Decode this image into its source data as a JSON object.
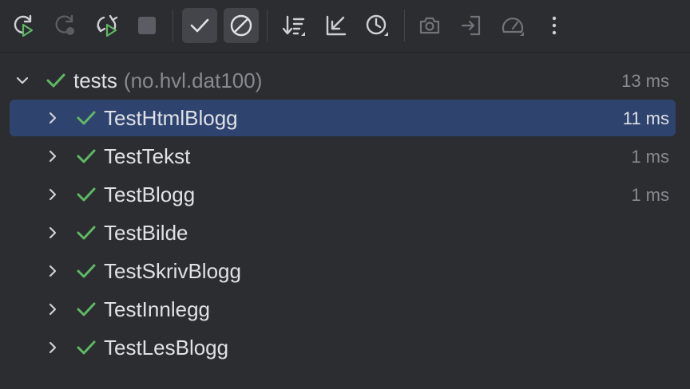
{
  "toolbar": {
    "buttons": [
      {
        "name": "rerun",
        "icon": "rerun-icon"
      },
      {
        "name": "rerun-failed",
        "icon": "rerun-failed-icon"
      },
      {
        "name": "toggle-auto-test",
        "icon": "auto-rerun-icon"
      },
      {
        "name": "stop",
        "icon": "stop-icon"
      },
      {
        "name": "show-passed",
        "icon": "checkmark-icon",
        "toggled": true
      },
      {
        "name": "show-ignored",
        "icon": "ignored-icon",
        "toggled": true
      },
      {
        "name": "sort-alphabetically",
        "icon": "sort-icon"
      },
      {
        "name": "collapse-all",
        "icon": "collapse-icon"
      },
      {
        "name": "sort-by-duration",
        "icon": "clock-icon"
      },
      {
        "name": "import-tests",
        "icon": "camera-icon"
      },
      {
        "name": "export-tests",
        "icon": "export-icon"
      },
      {
        "name": "coverage",
        "icon": "gauge-icon"
      },
      {
        "name": "more",
        "icon": "more-vertical-icon"
      }
    ]
  },
  "tree": {
    "root": {
      "name": "tests",
      "package": "(no.hvl.dat100)",
      "duration": "13 ms",
      "status": "passed",
      "expanded": true
    },
    "children": [
      {
        "name": "TestHtmlBlogg",
        "duration": "11 ms",
        "selected": true,
        "status": "passed"
      },
      {
        "name": "TestTekst",
        "duration": "1 ms",
        "status": "passed"
      },
      {
        "name": "TestBlogg",
        "duration": "1 ms",
        "status": "passed"
      },
      {
        "name": "TestBilde",
        "duration": "",
        "status": "passed"
      },
      {
        "name": "TestSkrivBlogg",
        "duration": "",
        "status": "passed"
      },
      {
        "name": "TestInnlegg",
        "duration": "",
        "status": "passed"
      },
      {
        "name": "TestLesBlogg",
        "duration": "",
        "status": "passed"
      }
    ]
  },
  "colors": {
    "background": "#2b2d30",
    "selection": "#2e436e",
    "pass_green": "#5fb865",
    "text": "#dfe1e5",
    "muted_text": "#868a91",
    "toggled_button": "#43454a"
  }
}
